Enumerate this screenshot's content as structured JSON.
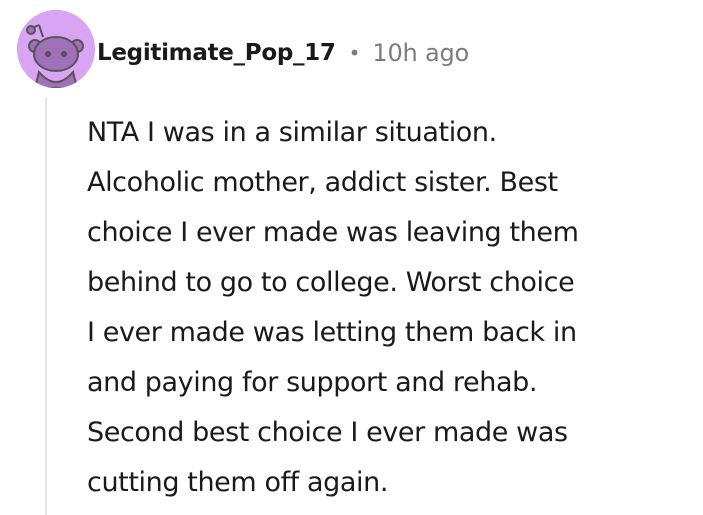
{
  "comment": {
    "author": "Legitimate_Pop_17",
    "separator": "•",
    "timestamp": "10h ago",
    "avatar_icon": "snoo-avatar-icon",
    "avatar_color": "#d8a4f3",
    "body_lines": [
      "NTA I was in a similar situation.",
      "Alcoholic mother, addict sister. Best",
      "choice I ever made was leaving them",
      "behind to go to college. Worst choice",
      "I ever made was letting them back in",
      "and paying for support and rehab.",
      "Second best choice I ever made was",
      "cutting them off again."
    ]
  }
}
